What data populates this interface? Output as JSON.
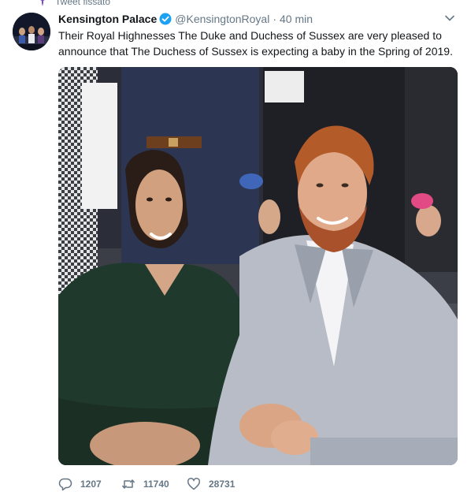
{
  "pinned": {
    "label": "Tweet fissato",
    "icon": "pin-icon"
  },
  "account": {
    "display_name": "Kensington Palace",
    "verified_icon": "verified-badge-icon",
    "handle": "@KensingtonRoyal",
    "separator": "·",
    "time": "40 min"
  },
  "tweet": {
    "text": "Their Royal Highnesses The Duke and Duchess of Sussex are very pleased to announce that The Duchess of Sussex is expecting a baby in the Spring of 2019."
  },
  "media": {
    "type": "photo"
  },
  "actions": {
    "reply_count": "1207",
    "retweet_count": "11740",
    "like_count": "28731"
  },
  "colors": {
    "text": "#14171a",
    "secondary": "#657786",
    "verified": "#1da1f2",
    "pin": "#794bc4"
  }
}
